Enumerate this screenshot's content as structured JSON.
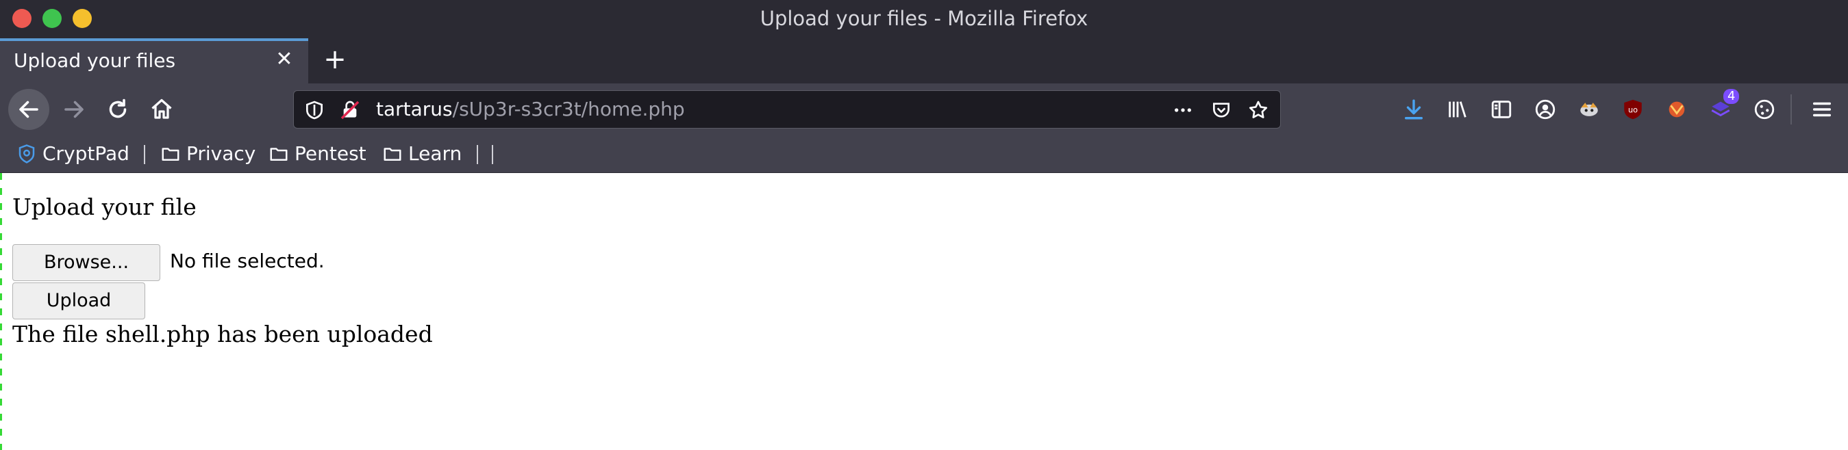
{
  "window": {
    "title": "Upload your files - Mozilla Firefox"
  },
  "tabs": [
    {
      "label": "Upload your files",
      "active": true
    }
  ],
  "urlbar": {
    "host": "tartarus",
    "path": "/sUp3r-s3cr3t/home.php"
  },
  "toolbar": {
    "extensions_badge": "4"
  },
  "bookmarks": [
    {
      "label": "CryptPad",
      "icon": "cryptpad-icon"
    },
    {
      "label": "Privacy",
      "icon": "folder-icon"
    },
    {
      "label": "Pentest",
      "icon": "folder-icon"
    },
    {
      "label": "Learn",
      "icon": "folder-icon"
    }
  ],
  "page": {
    "heading": "Upload your file",
    "browse_label": "Browse...",
    "file_status": "No file selected.",
    "upload_label": "Upload",
    "result": "The file shell.php has been uploaded"
  },
  "colors": {
    "chrome_dark": "#2b2a33",
    "toolbar": "#42414d",
    "urlbar_bg": "#1c1b22",
    "tab_accent": "#5b9bd5",
    "download_accent": "#4aa3f0"
  }
}
